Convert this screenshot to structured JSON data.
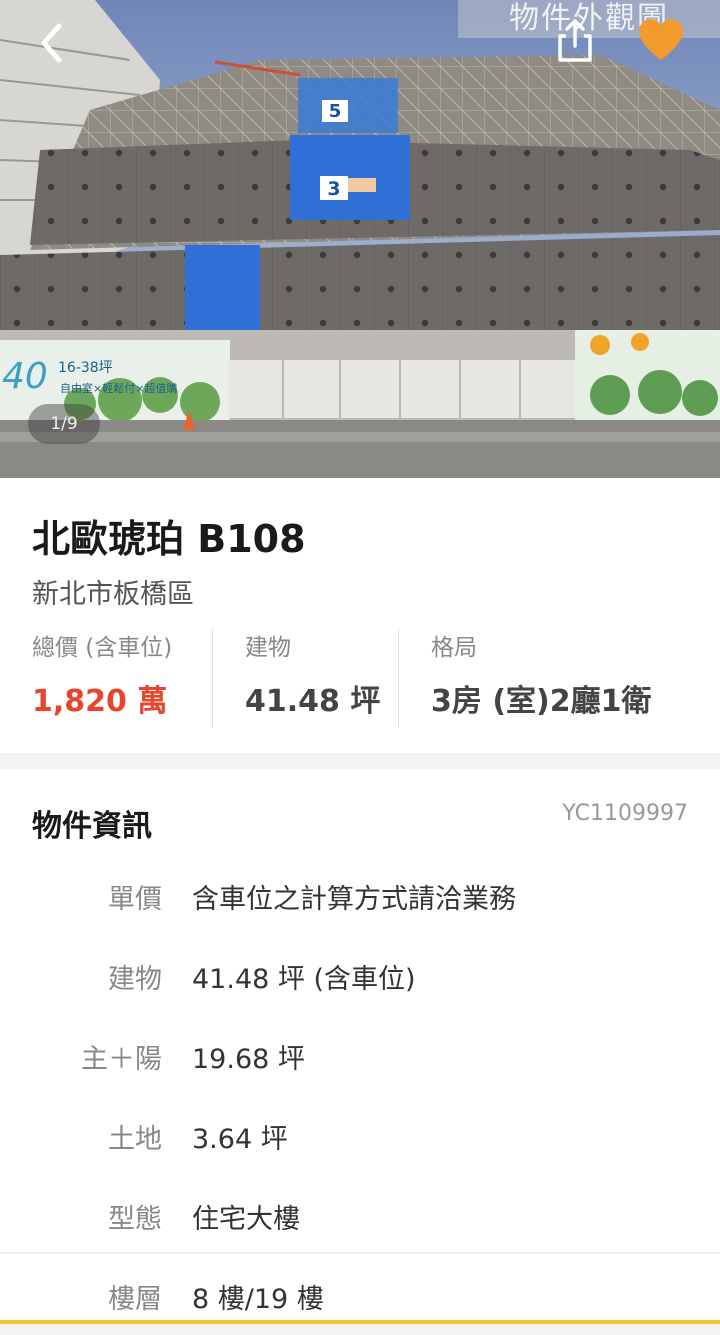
{
  "photo": {
    "watermark": "物件外觀圖",
    "counter": "1/9",
    "banner_left_big": "40",
    "banner_left_size": "16-38坪",
    "banner_left_feature": "自由室×輕鬆付×超值購",
    "floor_label_top": "5",
    "floor_label_mid": "3"
  },
  "header": {
    "back_icon": "chevron-left-icon",
    "share_icon": "share-icon",
    "favorite_icon": "heart-icon",
    "favorite_color": "#f39a2e"
  },
  "summary": {
    "title": "北歐琥珀 B108",
    "district": "新北市板橋區",
    "price_label": "總價 (含車位)",
    "price_value": "1,820 萬",
    "area_label": "建物",
    "area_value": "41.48 坪",
    "layout_label": "格局",
    "layout_value": "3房 (室)2廳1衛",
    "price_color": "#e8452c"
  },
  "info": {
    "title": "物件資訊",
    "id": "YC1109997",
    "rows": [
      {
        "key": "單價",
        "value": "含車位之計算方式請洽業務"
      },
      {
        "key": "建物",
        "value": "41.48 坪 (含車位)"
      },
      {
        "key": "主＋陽",
        "value": "19.68 坪"
      },
      {
        "key": "土地",
        "value": "3.64 坪"
      },
      {
        "key": "型態",
        "value": "住宅大樓"
      },
      {
        "key": "樓層",
        "value": "8 樓/19 樓"
      }
    ]
  }
}
